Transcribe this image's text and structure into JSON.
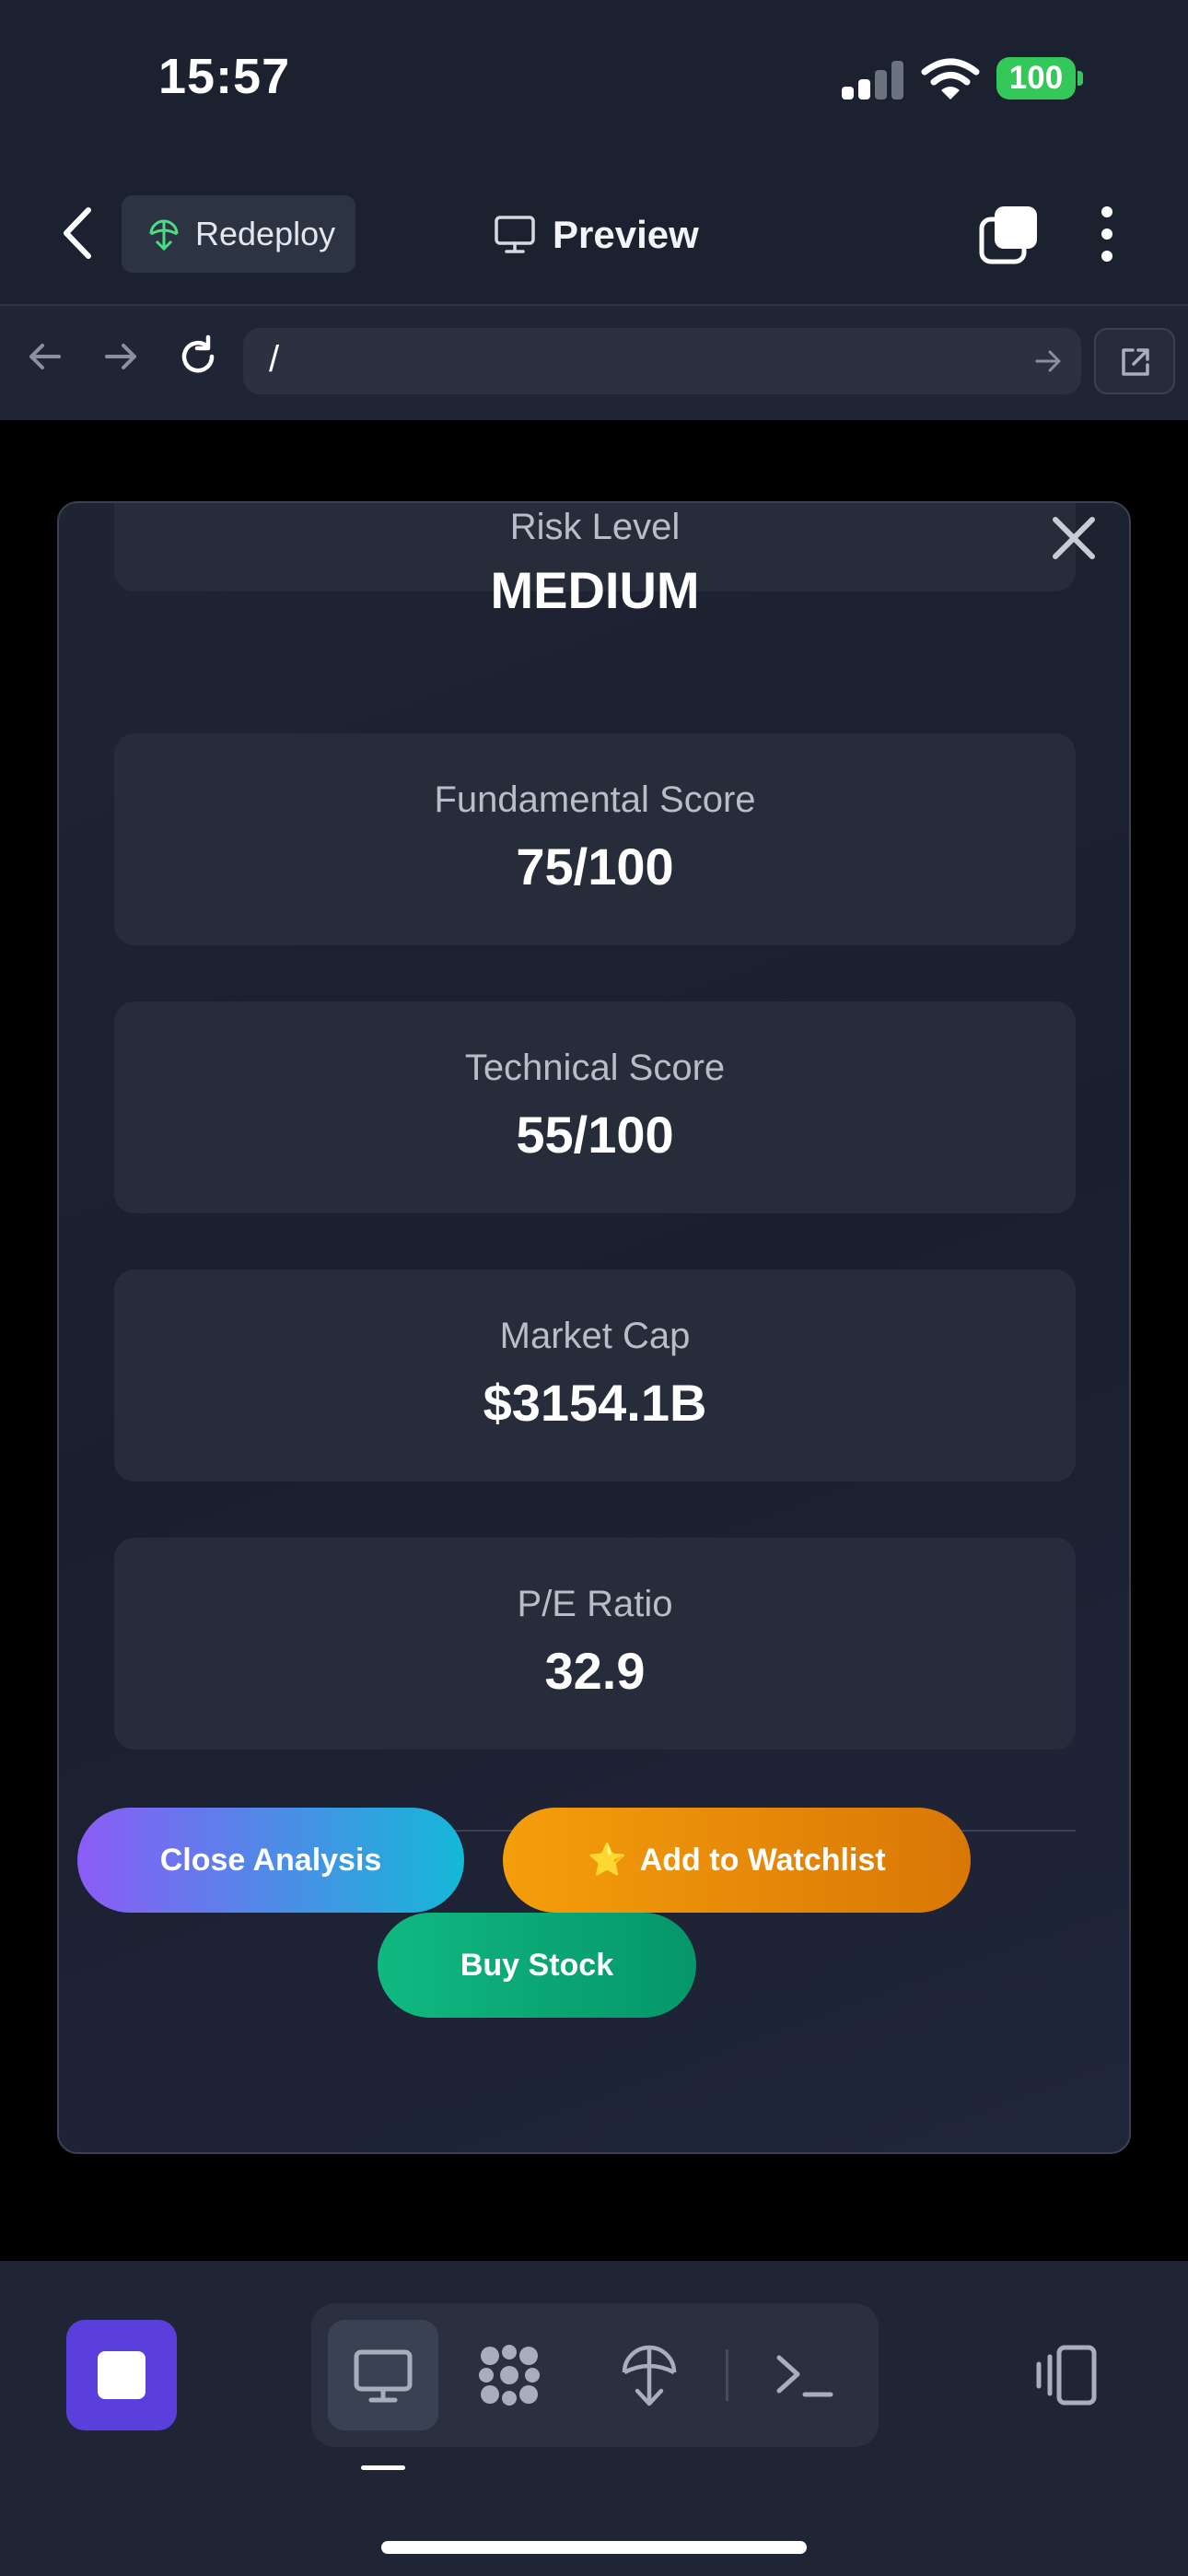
{
  "status_bar": {
    "time": "15:57",
    "battery": "100"
  },
  "header": {
    "redeploy_label": "Redeploy",
    "preview_label": "Preview"
  },
  "browser": {
    "url": "/"
  },
  "modal": {
    "cards": [
      {
        "label": "Risk Level",
        "value": "MEDIUM"
      },
      {
        "label": "Fundamental Score",
        "value": "75/100"
      },
      {
        "label": "Technical Score",
        "value": "55/100"
      },
      {
        "label": "Market Cap",
        "value": "$3154.1B"
      },
      {
        "label": "P/E Ratio",
        "value": "32.9"
      }
    ],
    "buttons": {
      "close": "Close Analysis",
      "watchlist_star": "⭐",
      "watchlist": "Add to Watchlist",
      "buy": "Buy Stock"
    }
  },
  "icons": {
    "status": [
      "signal-icon",
      "wifi-icon",
      "battery-icon"
    ],
    "header": [
      "back-chevron-icon",
      "redeploy-icon",
      "monitor-icon",
      "tabs-icon",
      "more-vertical-icon"
    ],
    "browser": [
      "nav-back-icon",
      "nav-forward-icon",
      "reload-icon",
      "go-arrow-icon",
      "open-external-icon"
    ],
    "modal": [
      "close-icon"
    ],
    "bottom": [
      "stop-icon",
      "desktop-icon",
      "apps-grid-icon",
      "deploy-icon",
      "terminal-icon",
      "device-toggle-icon"
    ]
  },
  "colors": {
    "background": "#1c2130",
    "battery": "#34c759",
    "stop_button": "#5a3fdc",
    "close_gradient": [
      "#8b5cf6",
      "#14b8d8"
    ],
    "watchlist_gradient": [
      "#f59e0b",
      "#d97706"
    ],
    "buy_gradient": [
      "#10b981",
      "#059669"
    ]
  }
}
